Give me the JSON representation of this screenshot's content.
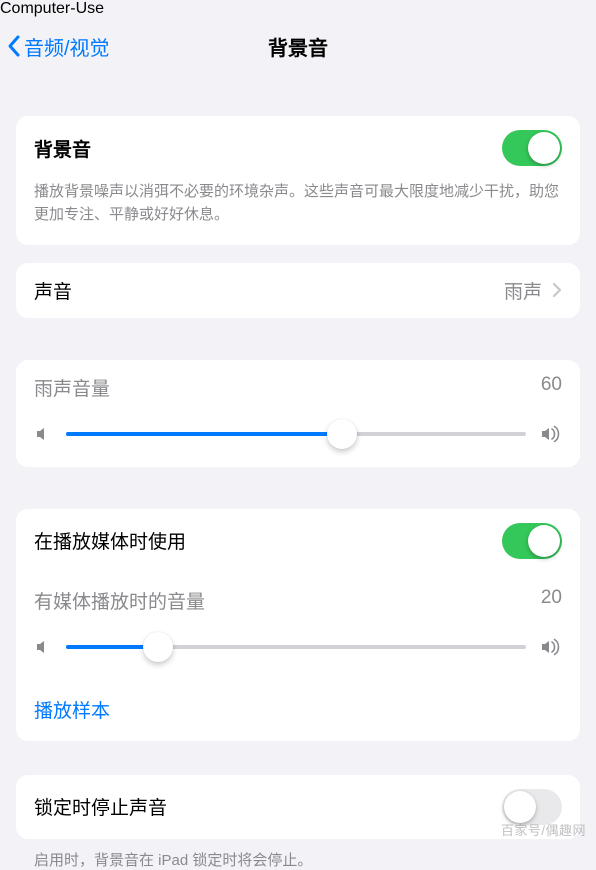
{
  "header": {
    "back_label": "音频/视觉",
    "title": "背景音"
  },
  "main_toggle": {
    "label": "背景音",
    "on": true,
    "description": "播放背景噪声以消弭不必要的环境杂声。这些声音可最大限度地减少干扰，助您更加专注、平静或好好休息。"
  },
  "sound_row": {
    "label": "声音",
    "value": "雨声"
  },
  "volume1": {
    "label": "雨声音量",
    "value": 60,
    "percent": 60
  },
  "media": {
    "use_label": "在播放媒体时使用",
    "use_on": true,
    "vol_label": "有媒体播放时的音量",
    "vol_value": 20,
    "vol_percent": 20,
    "sample_label": "播放样本"
  },
  "lock": {
    "label": "锁定时停止声音",
    "on": false,
    "note": "启用时，背景音在 iPad 锁定时将会停止。"
  },
  "watermark": "百家号/偶趣网"
}
